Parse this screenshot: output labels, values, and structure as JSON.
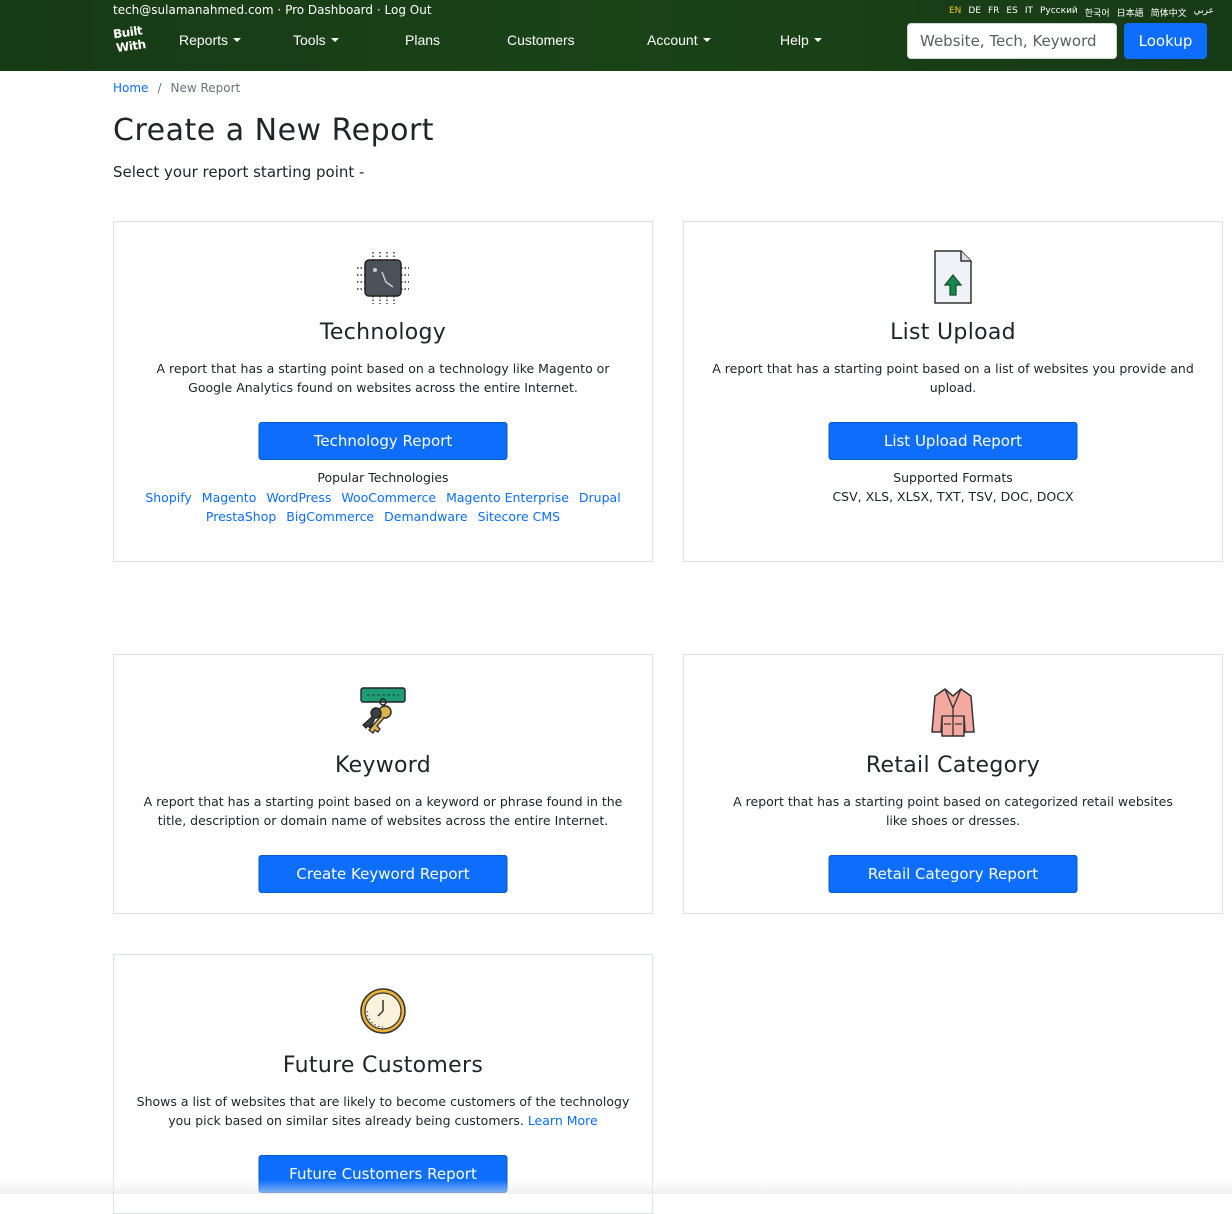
{
  "topbar": {
    "user_email": "tech@sulamanahmed.com",
    "pro_dashboard": "Pro Dashboard",
    "logout": "Log Out",
    "separator": "·",
    "logo_line1": "Built",
    "logo_line2": "With",
    "languages": [
      "EN",
      "DE",
      "FR",
      "ES",
      "IT",
      "Русский",
      "한국어",
      "日本語",
      "简体中文",
      "عربي"
    ],
    "active_language": "EN",
    "nav": {
      "reports": "Reports",
      "tools": "Tools",
      "plans": "Plans",
      "customers": "Customers",
      "account": "Account",
      "help": "Help"
    },
    "search_placeholder": "Website, Tech, Keyword",
    "lookup_label": "Lookup",
    "bg_color": "#1b4318",
    "accent_color": "#0d6efd"
  },
  "breadcrumb": {
    "home": "Home",
    "separator": "/",
    "current": "New Report"
  },
  "header": {
    "title": "Create a New Report",
    "subtitle": "Select your report starting point -"
  },
  "cards": {
    "technology": {
      "icon": "chip-icon",
      "title": "Technology",
      "description": "A report that has a starting point based on a technology like Magento or Google Analytics found on websites across the entire Internet.",
      "button": "Technology Report",
      "sub_label": "Popular Technologies",
      "popular": [
        "Shopify",
        "Magento",
        "WordPress",
        "WooCommerce",
        "Magento Enterprise",
        "Drupal",
        "PrestaShop",
        "BigCommerce",
        "Demandware",
        "Sitecore CMS"
      ]
    },
    "list_upload": {
      "icon": "file-upload-icon",
      "title": "List Upload",
      "description": "A report that has a starting point based on a list of websites you provide and upload.",
      "button": "List Upload Report",
      "sub_label": "Supported Formats",
      "formats": "CSV, XLS, XLSX, TXT, TSV, DOC, DOCX"
    },
    "keyword": {
      "icon": "keys-icon",
      "title": "Keyword",
      "description": "A report that has a starting point based on a keyword or phrase found in the title, description or domain name of websites across the entire Internet.",
      "button": "Create Keyword Report"
    },
    "retail": {
      "icon": "bathrobe-icon",
      "title": "Retail Category",
      "description": "A report that has a starting point based on categorized retail websites like shoes or dresses.",
      "button": "Retail Category Report"
    },
    "future": {
      "icon": "clock-icon",
      "title": "Future Customers",
      "description": "Shows a list of websites that are likely to become customers of the technology you pick based on similar sites already being customers.",
      "learn_more": "Learn More",
      "button": "Future Customers Report"
    }
  }
}
